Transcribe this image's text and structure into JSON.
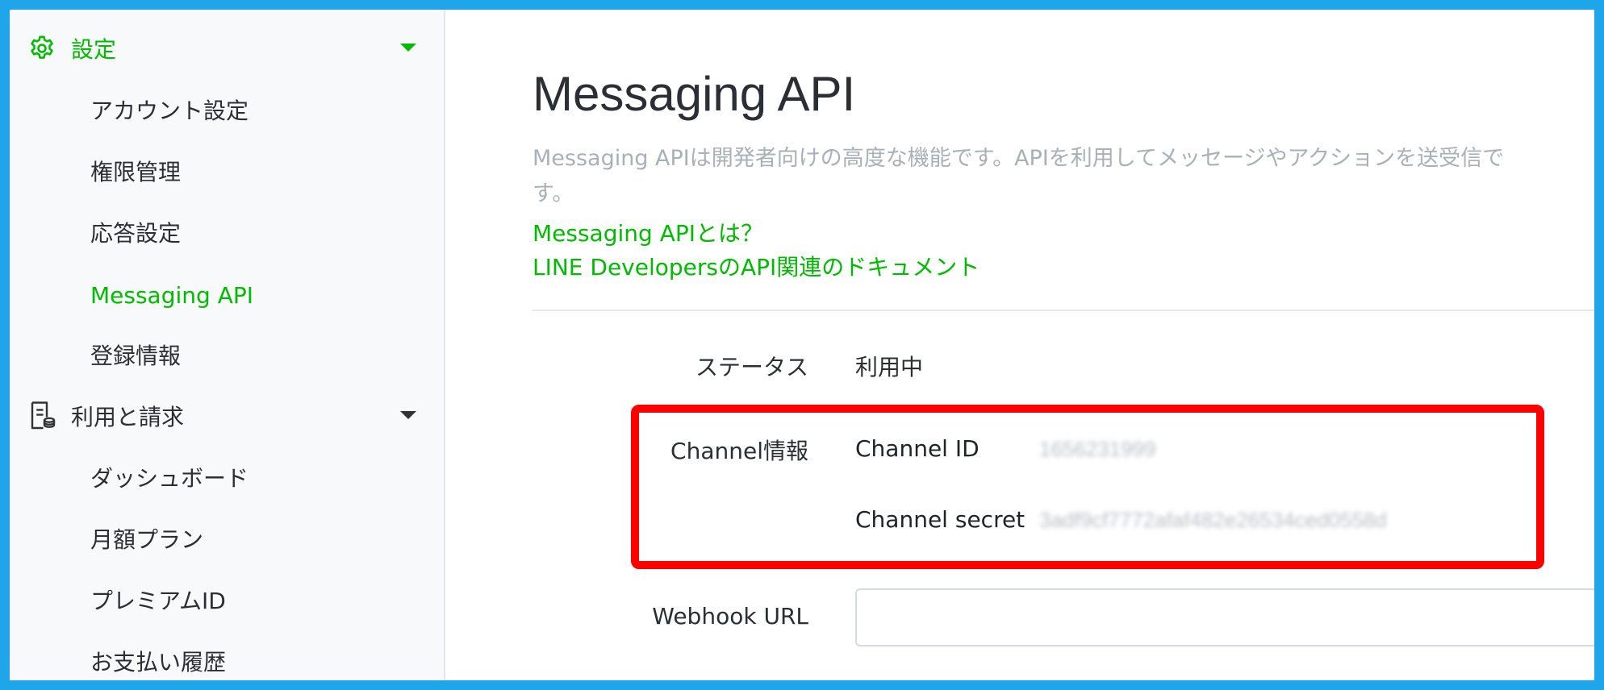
{
  "sidebar": {
    "settings_section": {
      "label": "設定",
      "icon": "gear-icon"
    },
    "settings_items": [
      {
        "label": "アカウント設定"
      },
      {
        "label": "権限管理"
      },
      {
        "label": "応答設定"
      },
      {
        "label": "Messaging API"
      },
      {
        "label": "登録情報"
      }
    ],
    "billing_section": {
      "label": "利用と請求",
      "icon": "document-billing-icon"
    },
    "billing_items": [
      {
        "label": "ダッシュボード"
      },
      {
        "label": "月額プラン"
      },
      {
        "label": "プレミアムID"
      },
      {
        "label": "お支払い履歴"
      }
    ]
  },
  "main": {
    "title": "Messaging API",
    "description_line1": "Messaging APIは開発者向けの高度な機能です。APIを利用してメッセージやアクションを送受信で",
    "description_line2": "す。",
    "link_what_is": "Messaging APIとは？",
    "link_docs": "LINE DevelopersのAPI関連のドキュメント",
    "status": {
      "label": "ステータス",
      "value": "利用中"
    },
    "channel_info": {
      "label": "Channel情報",
      "channel_id_label": "Channel ID",
      "channel_id_value": "1656231999",
      "channel_secret_label": "Channel secret",
      "channel_secret_value": "3adf9cf7772afaf482e26534ced0558d"
    },
    "webhook": {
      "label": "Webhook URL",
      "value": ""
    }
  },
  "colors": {
    "accent": "#00b900",
    "frame": "#1fa5e9",
    "highlight": "#ff0000"
  }
}
